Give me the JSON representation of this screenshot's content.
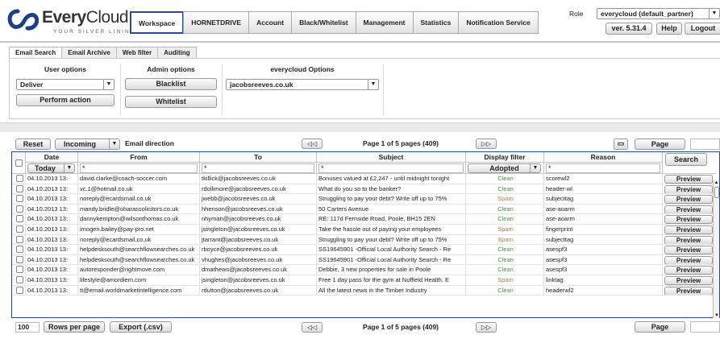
{
  "brand": {
    "name_a": "Every",
    "name_b": "Cloud",
    "tagline": "YOUR SILVER LINING",
    "accent": "#1e3f86"
  },
  "nav": [
    "Workspace",
    "HORNETDRIVE",
    "Account",
    "Black/Whitelist",
    "Management",
    "Statistics",
    "Notification Service"
  ],
  "header": {
    "role_label": "Role",
    "role_value": "everycloud (default_partner)",
    "version": "ver. 5.31.4",
    "help": "Help",
    "logout": "Logout"
  },
  "subtabs": [
    "Email Search",
    "Email Archive",
    "Web filter",
    "Auditing"
  ],
  "options": {
    "user_title": "User options",
    "user_select": "Deliver",
    "perform": "Perform action",
    "admin_title": "Admin options",
    "blacklist": "Blacklist",
    "whitelist": "Whitelist",
    "ec_title": "everycloud Options",
    "ec_select": "jacobsreeves.co.uk"
  },
  "toolbar": {
    "reset": "Reset",
    "direction_select": "Incoming",
    "direction_label": "Email direction",
    "page_info": "Page 1 of 5 pages (409)",
    "page_btn": "Page",
    "page_value": ""
  },
  "columns": [
    "Date",
    "From",
    "To",
    "Subject",
    "Display filter",
    "Reason"
  ],
  "filters": {
    "date": "Today",
    "from": "*",
    "to": "*",
    "subject": "*",
    "display": "Adopted",
    "reason": "*",
    "search": "Search"
  },
  "rows": [
    {
      "date": "04.10.2013 13:",
      "from": "david.clarke@coach-soccer.com",
      "to": "tkillick@jacobsreeves.co.uk",
      "subject": "Bonuses valued at £2,247 - until midnight tonight",
      "status": "Clean",
      "reason": "scorewl2"
    },
    {
      "date": "04.10.2013 13:",
      "from": "vc.1@hotmail.co.uk",
      "to": "rdollimore@jacobsreeves.co.uk",
      "subject": "What do you so to the banker?",
      "status": "Clean",
      "reason": "header-wl"
    },
    {
      "date": "04.10.2013 13:",
      "from": "noreply@ecardsmail.co.uk",
      "to": "jwebb@jacobsreeves.co.uk",
      "subject": "Struggling to pay your debt? Write off up to 75%",
      "status": "Spam",
      "reason": "subjecttag"
    },
    {
      "date": "04.10.2013 13:",
      "from": "mandy.bridle@oharassolicitors.co.uk",
      "to": "hhenson@jacobsreeves.co.uk",
      "subject": "50 Carters Avenue",
      "status": "Clean",
      "reason": "ase-aoarm"
    },
    {
      "date": "04.10.2013 13:",
      "from": "dannykempton@wilsonthomas.co.uk",
      "to": "nhyman@jacobsreeves.co.uk",
      "subject": "RE: 117d Fernside Road, Poole, BH15 2EN",
      "status": "Clean",
      "reason": "ase-aoarm"
    },
    {
      "date": "04.10.2013 13:",
      "from": "imogen.bailey@pay-pro.net",
      "to": "jsingleton@jacobsreeves.co.uk",
      "subject": "Take the hassle out of paying your employees",
      "status": "Spam",
      "reason": "fingerprint"
    },
    {
      "date": "04.10.2013 13:",
      "from": "noreply@ecardsmail.co.uk",
      "to": "jtarrant@jacobsreeves.co.uk",
      "subject": "Struggling to pay your debt? Write off up to 75%",
      "status": "Spam",
      "reason": "subjecttag"
    },
    {
      "date": "04.10.2013 13:",
      "from": "helpdesksouth@searchflowsearches.co.uk",
      "to": "rboyce@jacobsreeves.co.uk",
      "subject": "SS19645901 -Official Local Authority Search - Re",
      "status": "Clean",
      "reason": "asespf3"
    },
    {
      "date": "04.10.2013 13:",
      "from": "helpdesksouth@searchflowsearches.co.uk",
      "to": "vhughes@jacobsreeves.co.uk",
      "subject": "SS19645901 -Official Local Authority Search - Re",
      "status": "Clean",
      "reason": "asespf3"
    },
    {
      "date": "04.10.2013 13:",
      "from": "autoresponder@rightmove.com",
      "to": "dmathews@jacobsreeves.co.uk",
      "subject": "Debbie, 3 new properties for sale in Poole",
      "status": "Clean",
      "reason": "asespf3"
    },
    {
      "date": "04.10.2013 13:",
      "from": "lifestyle@amordiem.com",
      "to": "jsingleton@jacobsreeves.co.uk",
      "subject": "Free 1 day pass for the gym at Nuffield Health. E",
      "status": "Spam",
      "reason": "linktag"
    },
    {
      "date": "04.10.2013 13:",
      "from": "tt@email.worldmarketintelligence.com",
      "to": "rdutton@jacobsreeves.co.uk",
      "subject": "All the latest news in the Timber Industry",
      "status": "Clean",
      "reason": "headerwl2"
    }
  ],
  "preview_label": "Preview",
  "footer": {
    "rows_value": "100",
    "rows_per_page": "Rows per page",
    "export": "Export (.csv)",
    "page_info": "Page 1 of 5 pages (409)",
    "page_btn": "Page"
  },
  "colors": {
    "clean": "#3b9e2b",
    "spam": "#c9782a",
    "border": "#2c4a8c"
  }
}
